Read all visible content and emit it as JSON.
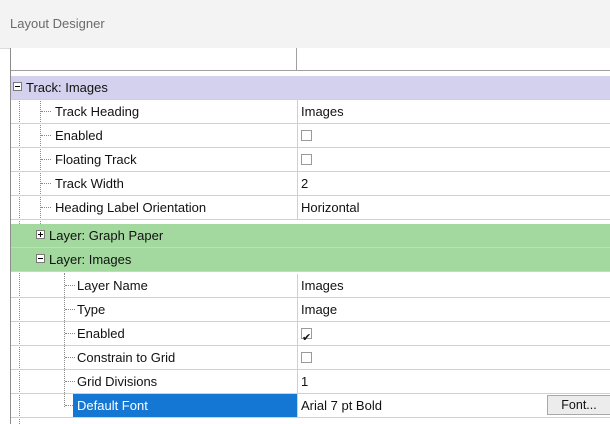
{
  "window": {
    "title": "Layout Designer"
  },
  "section": {
    "label": "Track: Images"
  },
  "track_properties": [
    {
      "name": "Track Heading",
      "value": "Images",
      "kind": "text"
    },
    {
      "name": "Enabled",
      "value": "",
      "kind": "checkbox",
      "checked": false
    },
    {
      "name": "Floating Track",
      "value": "",
      "kind": "checkbox",
      "checked": false
    },
    {
      "name": "Track Width",
      "value": "2",
      "kind": "text"
    },
    {
      "name": "Heading Label Orientation",
      "value": "Horizontal",
      "kind": "text"
    }
  ],
  "layers": [
    {
      "label": "Layer: Graph Paper",
      "expanded": false
    },
    {
      "label": "Layer: Images",
      "expanded": true
    }
  ],
  "layer_properties": [
    {
      "name": "Layer Name",
      "value": "Images",
      "kind": "text"
    },
    {
      "name": "Type",
      "value": "Image",
      "kind": "text"
    },
    {
      "name": "Enabled",
      "value": "",
      "kind": "checkbox",
      "checked": true
    },
    {
      "name": "Constrain to Grid",
      "value": "",
      "kind": "checkbox",
      "checked": false
    },
    {
      "name": "Grid Divisions",
      "value": "1",
      "kind": "text"
    },
    {
      "name": "Default Font",
      "value": "Arial 7 pt Bold",
      "kind": "font",
      "button_label": "Font...",
      "selected": true
    }
  ],
  "colors": {
    "section_bg": "#d3d1ee",
    "layer_bg": "#a3d99f",
    "selection": "#1577d4"
  }
}
